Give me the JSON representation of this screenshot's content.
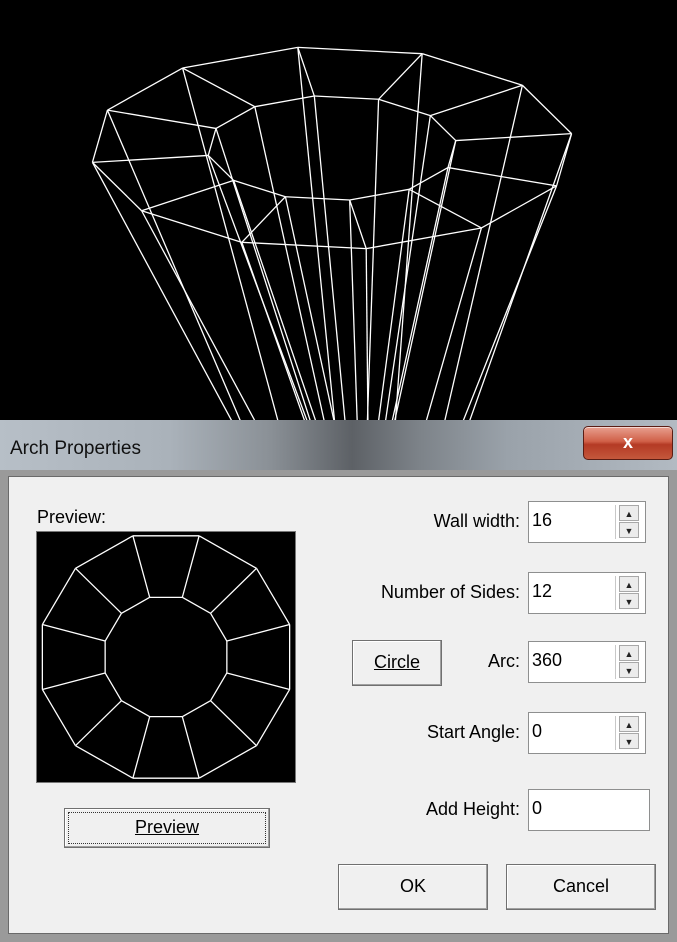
{
  "dialog": {
    "title": "Arch Properties",
    "close_glyph": "x",
    "preview_label": "Preview:",
    "preview_button": "Preview",
    "wall_width": {
      "label": "Wall width:",
      "value": "16"
    },
    "number_of_sides": {
      "label": "Number of Sides:",
      "value": "12"
    },
    "circle_button": "Circle",
    "arc": {
      "label": "Arc:",
      "value": "360"
    },
    "start_angle": {
      "label": "Start Angle:",
      "value": "0"
    },
    "add_height": {
      "label": "Add Height:",
      "value": "0"
    },
    "ok_button": "OK",
    "cancel_button": "Cancel"
  },
  "icons": {
    "close": "close-icon",
    "spin_up": "arrow-up-icon",
    "spin_down": "arrow-down-icon"
  },
  "colors": {
    "close_button": "#c4583c",
    "viewport_bg": "#000000",
    "wireframe": "#ffffff"
  }
}
